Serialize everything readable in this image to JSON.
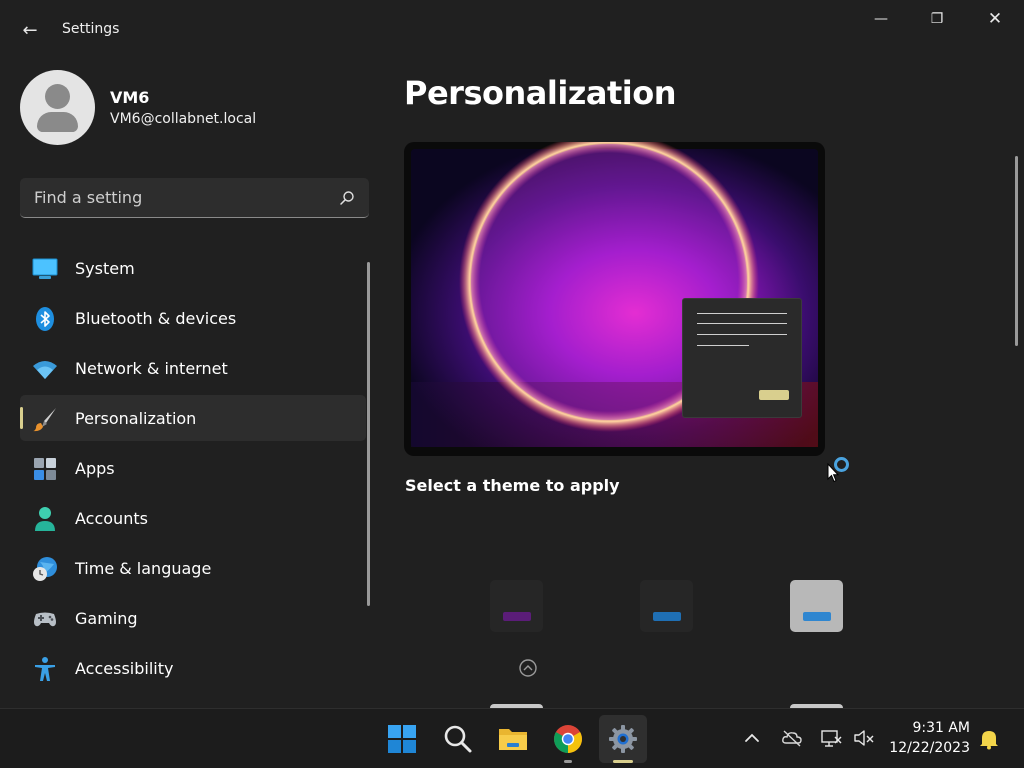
{
  "window": {
    "title": "Settings",
    "back_glyph": "←",
    "minimize_glyph": "—",
    "maximize_glyph": "❐",
    "close_glyph": "✕"
  },
  "profile": {
    "name": "VM6",
    "email": "VM6@collabnet.local"
  },
  "search": {
    "placeholder": "Find a setting",
    "icon": "search-icon"
  },
  "nav": {
    "items": [
      {
        "label": "System",
        "icon": "monitor-icon"
      },
      {
        "label": "Bluetooth & devices",
        "icon": "bluetooth-icon"
      },
      {
        "label": "Network & internet",
        "icon": "wifi-icon"
      },
      {
        "label": "Personalization",
        "icon": "paintbrush-icon",
        "active": true
      },
      {
        "label": "Apps",
        "icon": "apps-icon"
      },
      {
        "label": "Accounts",
        "icon": "person-icon"
      },
      {
        "label": "Time & language",
        "icon": "globe-clock-icon"
      },
      {
        "label": "Gaming",
        "icon": "gamepad-icon"
      },
      {
        "label": "Accessibility",
        "icon": "accessibility-icon"
      }
    ]
  },
  "main": {
    "title": "Personalization",
    "theme_heading": "Select a theme to apply"
  },
  "themes": [
    {
      "icon": "theme-glow",
      "bg": "#2a2a2a",
      "bar": "#5b1d78"
    },
    {
      "icon": "theme-dark",
      "bg": "#2a2a2a",
      "bar": "#1f6fb4"
    },
    {
      "icon": "theme-light",
      "bg": "#b8b8b8",
      "bar": "#2f86d0"
    }
  ],
  "taskbar": {
    "apps": [
      "windows-start-icon",
      "search-icon",
      "file-explorer-icon",
      "chrome-icon",
      "settings-icon"
    ],
    "clock_time": "9:31 AM",
    "clock_date": "12/22/2023"
  },
  "colors": {
    "accent": "#d9cf8e",
    "background": "#202020",
    "surface": "#2d2d2d"
  }
}
